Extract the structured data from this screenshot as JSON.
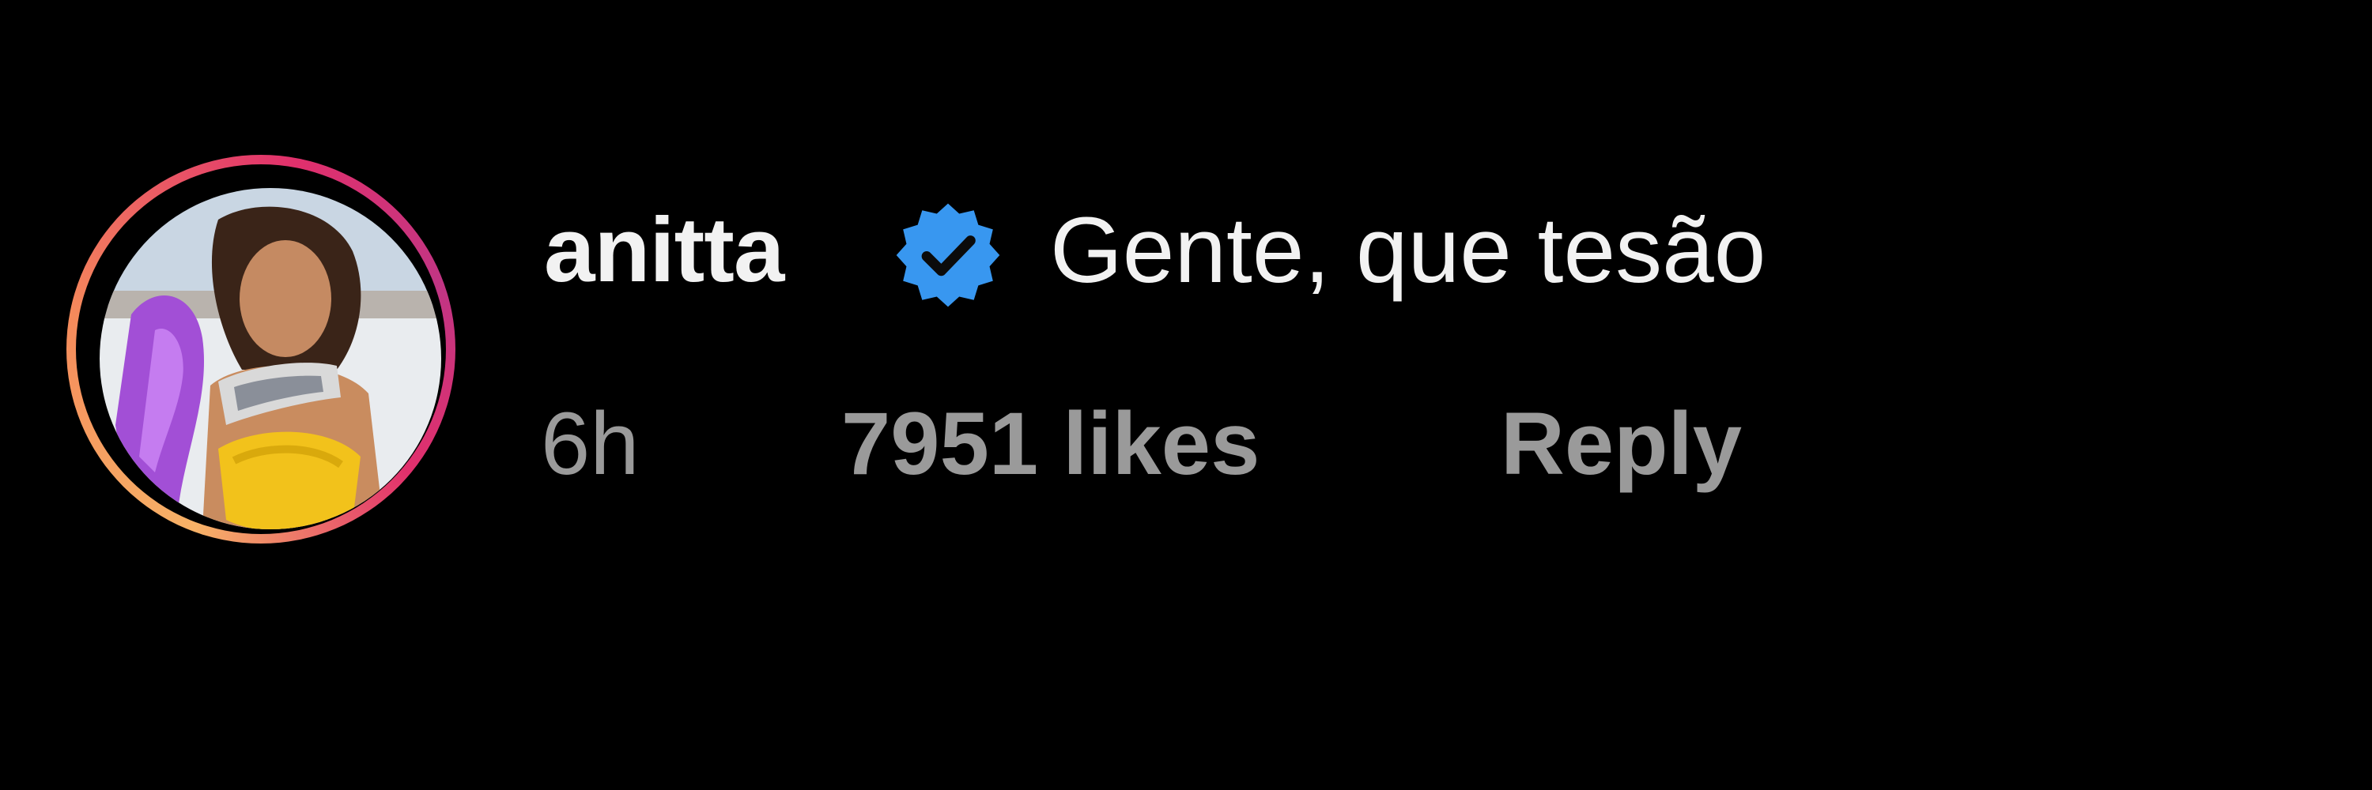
{
  "comment": {
    "username": "anitta",
    "verified_icon": "verified-badge-icon",
    "text": "Gente, que tesão",
    "time": "6h",
    "likes": "7951 likes",
    "reply_label": "Reply"
  },
  "colors": {
    "background": "#000000",
    "primary_text": "#f2f2f2",
    "secondary_text": "#9a9a9a",
    "verified_blue": "#3897f0"
  }
}
